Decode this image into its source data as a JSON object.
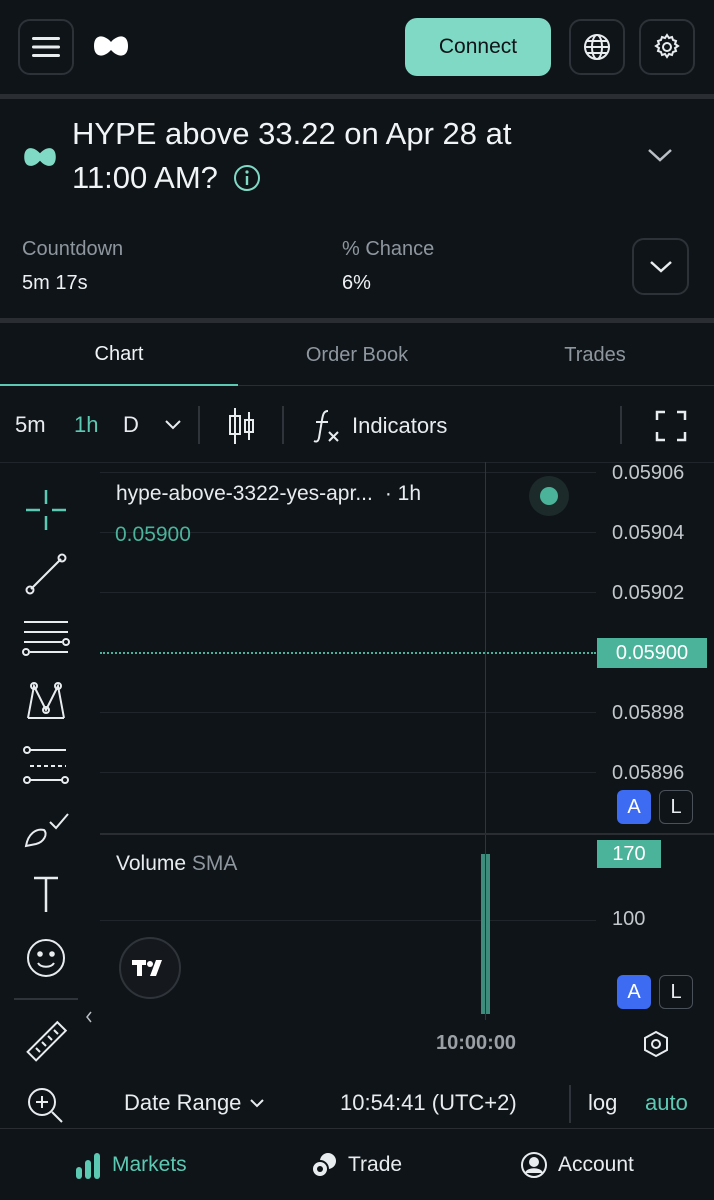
{
  "header": {
    "connect_label": "Connect"
  },
  "market": {
    "title": "HYPE above 33.22 on Apr 28 at 11:00 AM?",
    "countdown_label": "Countdown",
    "countdown_value": "5m 17s",
    "chance_label": "% Chance",
    "chance_value": "6%"
  },
  "tabs": [
    {
      "label": "Chart",
      "active": true
    },
    {
      "label": "Order Book",
      "active": false
    },
    {
      "label": "Trades",
      "active": false
    }
  ],
  "toolbar": {
    "interval_5m": "5m",
    "interval_1h": "1h",
    "interval_d": "D",
    "indicators_label": "Indicators"
  },
  "chart": {
    "symbol": "hype-above-3322-yes-apr...",
    "interval": "· 1h",
    "last_price": "0.05900",
    "y_ticks": [
      "0.05906",
      "0.05904",
      "0.05902",
      "0.05900",
      "0.05898",
      "0.05896"
    ],
    "price_tag": "0.05900",
    "volume_label": "Volume",
    "volume_sma": "SMA",
    "volume_tag": "170",
    "volume_tick": "100",
    "time_tag": "10:00:00",
    "badge_a": "A",
    "badge_l": "L",
    "accent": "#4bb39a",
    "price_last": 0.059,
    "volume_value": 170
  },
  "chart_data": {
    "type": "line",
    "y_ticks": [
      0.05906,
      0.05904,
      0.05902,
      0.059,
      0.05898,
      0.05896
    ],
    "x": [
      "10:00:00"
    ],
    "values": [
      0.059
    ],
    "volume": [
      170
    ],
    "volume_ticks": [
      100
    ]
  },
  "footer": {
    "date_range": "Date Range",
    "time": "10:54:41 (UTC+2)",
    "log": "log",
    "auto": "auto"
  },
  "nav": {
    "markets": "Markets",
    "trade": "Trade",
    "account": "Account"
  },
  "colors": {
    "brand": "#7fd9c4",
    "badge_blue": "#3d6bf2",
    "teal_active": "#5cc9b3"
  }
}
